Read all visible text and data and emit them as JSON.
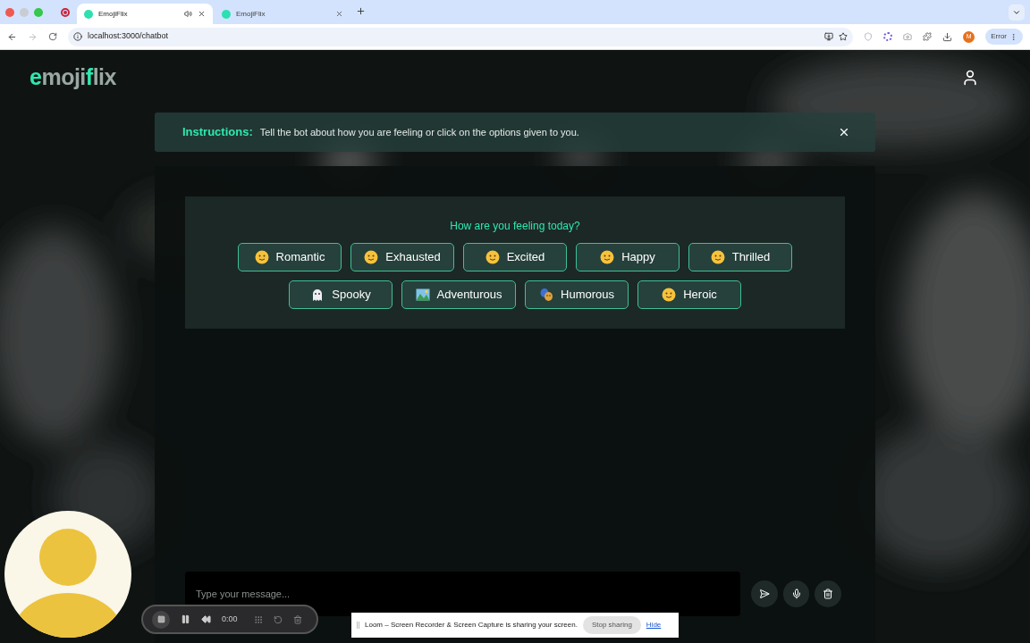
{
  "browser": {
    "tabs": [
      {
        "title": "EmojiFlix",
        "selected": true,
        "audio": true
      },
      {
        "title": "EmojiFlix",
        "selected": false,
        "audio": false
      }
    ],
    "url": "localhost:3000/chatbot",
    "profile_initial": "M",
    "error_label": "Error"
  },
  "header": {
    "logo": [
      {
        "text": "e",
        "accent": true
      },
      {
        "text": "moji",
        "accent": false
      },
      {
        "text": "f",
        "accent": true
      },
      {
        "text": "lix",
        "accent": false
      }
    ]
  },
  "instructions": {
    "label": "Instructions:",
    "text": "Tell the bot about how you are feeling or click on the options given to you."
  },
  "chat": {
    "question": "How are you feeling today?",
    "mood_rows": [
      [
        {
          "label": "Romantic",
          "kind": "face"
        },
        {
          "label": "Exhausted",
          "kind": "face"
        },
        {
          "label": "Excited",
          "kind": "face"
        },
        {
          "label": "Happy",
          "kind": "face"
        },
        {
          "label": "Thrilled",
          "kind": "face"
        }
      ],
      [
        {
          "label": "Spooky",
          "kind": "ghost"
        },
        {
          "label": "Adventurous",
          "kind": "landscape"
        },
        {
          "label": "Humorous",
          "kind": "masks"
        },
        {
          "label": "Heroic",
          "kind": "face"
        }
      ]
    ],
    "input": {
      "placeholder": "Type your message..."
    }
  },
  "recorder": {
    "time": "0:00"
  },
  "share_bar": {
    "text": "Loom – Screen Recorder & Screen Capture is sharing your screen.",
    "stop": "Stop sharing",
    "hide": "Hide"
  }
}
